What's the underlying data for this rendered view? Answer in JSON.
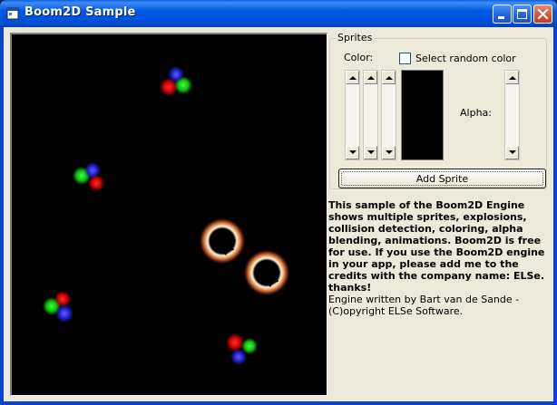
{
  "window": {
    "title": "Boom2D Sample",
    "icon": "app-icon"
  },
  "titlebar_buttons": {
    "minimize": "minimize-icon",
    "maximize": "maximize-icon",
    "close": "close-icon"
  },
  "sprites_group": {
    "label": "Sprites",
    "color_label": "Color:",
    "random_color_label": "Select random color",
    "random_color_checked": false,
    "alpha_label": "Alpha:",
    "swatch_color": "#000000",
    "add_sprite_label": "Add Sprite"
  },
  "description": "This sample of the Boom2D Engine shows multiple sprites, explosions, collision detection, coloring, alpha blending, animations. Boom2D is free for use. If you use the Boom2D engine in your app, please add me to the credits with the company name: ELSe. thanks!",
  "credits": "Engine written by Bart van de Sande - (C)opyright ELSe Software.",
  "colors": {
    "titlebar": "#0058e6",
    "client_bg": "#ece9d8",
    "canvas_bg": "#000000"
  }
}
